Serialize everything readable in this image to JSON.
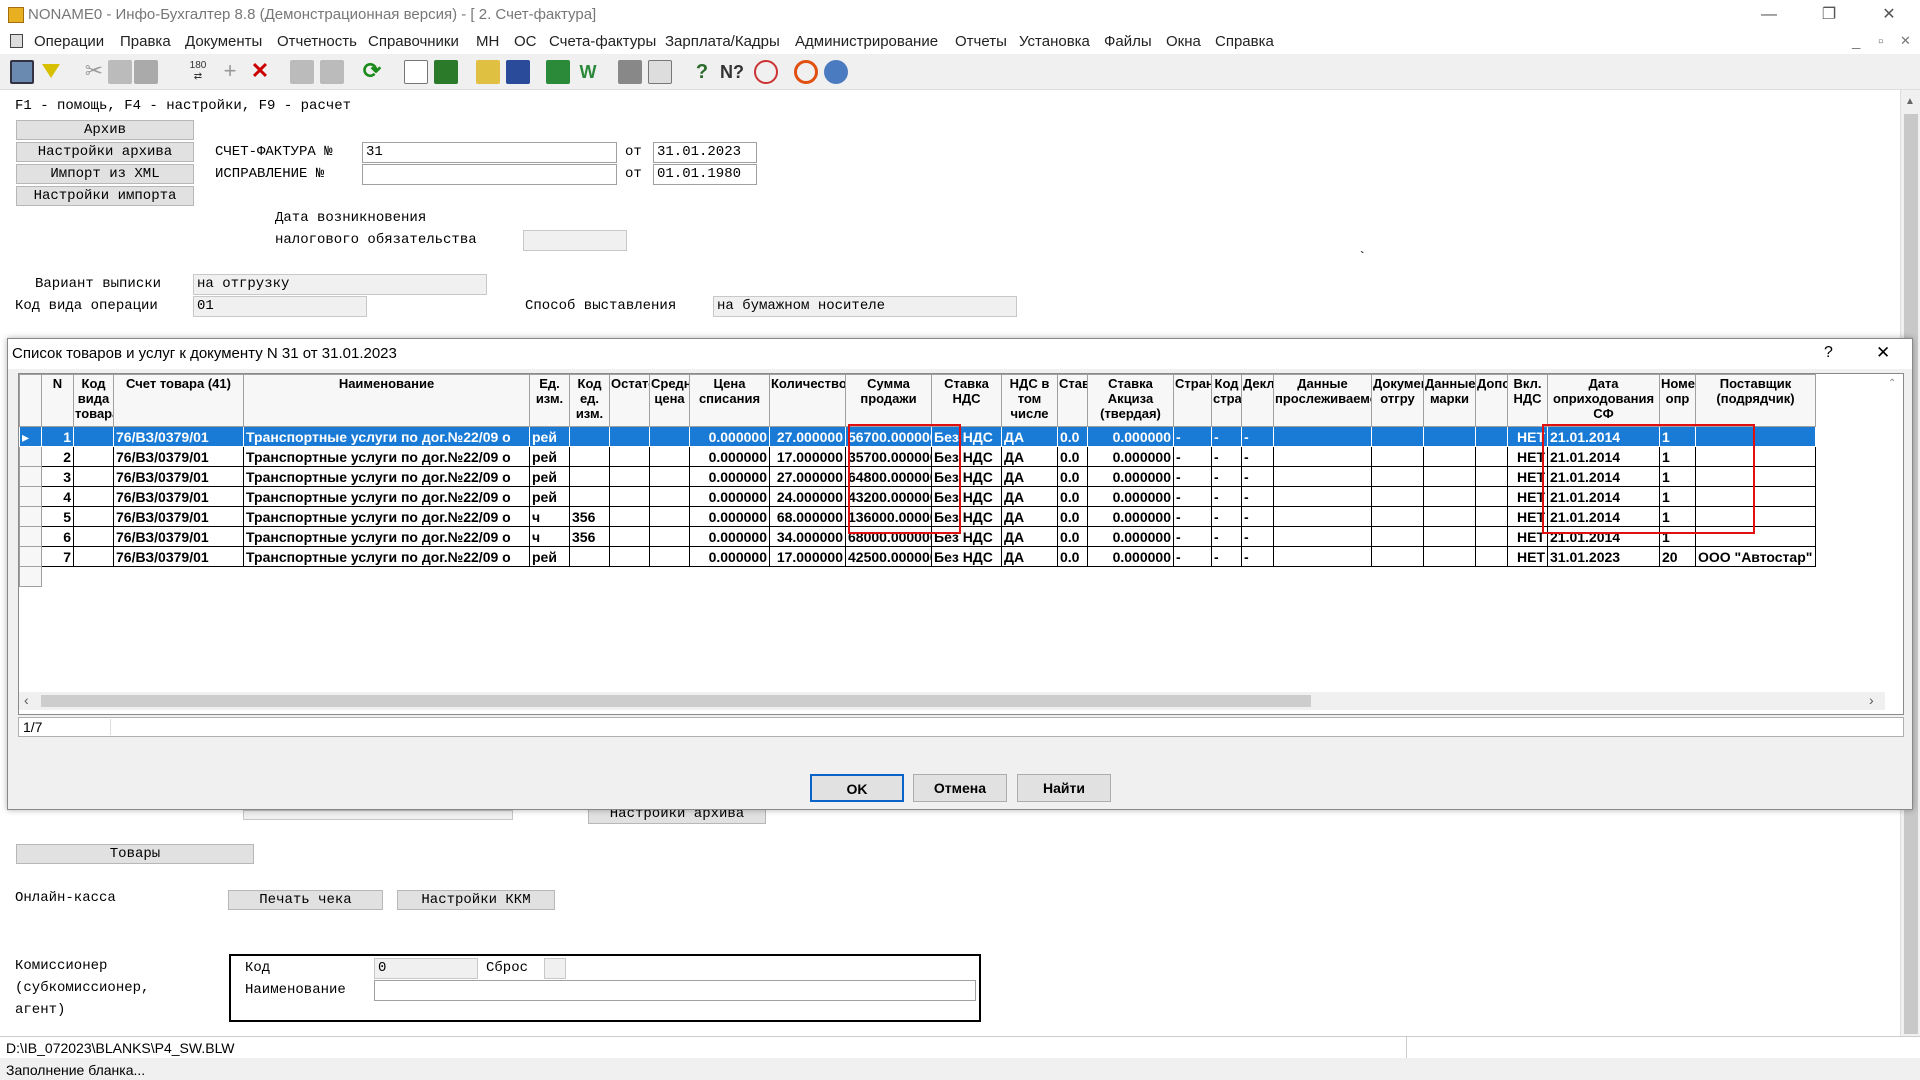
{
  "window": {
    "title": "NONAME0 - Инфо-Бухгалтер 8.8 (Демонстрационная версия) - [  2. Счет-фактура]",
    "minimize": "—",
    "maximize": "❐",
    "close": "✕"
  },
  "menu": [
    "Операции",
    "Правка",
    "Документы",
    "Отчетность",
    "Справочники",
    "МН",
    "ОС",
    "Счета-фактуры",
    "Зарплата/Кадры",
    "Администрирование",
    "Отчеты",
    "Установка",
    "Файлы",
    "Окна",
    "Справка"
  ],
  "mdi_controls": [
    "_",
    "▫",
    "✕"
  ],
  "form": {
    "hint": "F1 - помощь, F4 - настройки, F9 - расчет",
    "btn_archive": "Архив",
    "btn_archive_settings": "Настройки архива",
    "btn_import_xml": "Импорт из XML",
    "btn_import_settings": "Настройки импорта",
    "invoice_label": "СЧЕТ-ФАКТУРА №",
    "invoice_no": "31",
    "from1": "от",
    "invoice_date": "31.01.2023",
    "correction_label": "ИСПРАВЛЕНИЕ  №",
    "correction_no": "",
    "from2": "от",
    "correction_date": "01.01.1980",
    "tax_date_label1": "Дата возникновения",
    "tax_date_label2": "налогового обязательства",
    "tax_date": "",
    "variant_label": "Вариант выписки",
    "variant_value": "на отгрузку",
    "opcode_label": "Код вида операции",
    "opcode_value": "01",
    "method_label": "Способ выставления",
    "method_value": "на бумажном носителе",
    "backtick": "`",
    "btn_archive_settings2": "Настройки архива",
    "btn_goods": "Товары",
    "online_kassa": "Онлайн-касса",
    "btn_print_check": "Печать чека",
    "btn_kkm_settings": "Настройки ККМ",
    "commissioner1": "Комиссионер",
    "commissioner2": "(субкомиссионер,",
    "commissioner3": "агент)",
    "code_label": "Код",
    "code_value": "0",
    "reset_label": "Сброс",
    "name_label": "Наименование",
    "name_value": ""
  },
  "dialog": {
    "title": "Список товаров и услуг к документу N 31 от 31.01.2023",
    "help": "?",
    "close": "✕",
    "columns": [
      "N",
      "Код вида товара",
      "Счет товара (41)",
      "Наименование",
      "Ед. изм.",
      "Код ед. изм.",
      "Остаток",
      "Средняя цена",
      "Цена списания",
      "Количество",
      "Сумма продажи",
      "Ставка НДС",
      "НДС в том числе",
      "Ставка",
      "Ставка Акциза (твердая)",
      "Страна",
      "Код страны",
      "Декларации",
      "Данные прослеживаемости",
      "Документы отгру",
      "Данные марки",
      "Дополнит",
      "Вкл. НДС",
      "Дата оприходования СФ",
      "Номер опр",
      "Поставщик (подрядчик)"
    ],
    "rows": [
      [
        "1",
        "",
        "76/ВЗ/0379/01",
        "Транспортные услуги по дог.№22/09 о",
        "рей",
        "",
        "",
        "",
        "0.000000",
        "27.000000",
        "56700.000000",
        "Без НДС",
        "ДА",
        "0.0",
        "0.000000",
        "-",
        "-",
        "-",
        "",
        "",
        "",
        "",
        "НЕТ",
        "21.01.2014",
        "1",
        ""
      ],
      [
        "2",
        "",
        "76/ВЗ/0379/01",
        "Транспортные услуги по дог.№22/09 о",
        "рей",
        "",
        "",
        "",
        "0.000000",
        "17.000000",
        "35700.000000",
        "Без НДС",
        "ДА",
        "0.0",
        "0.000000",
        "-",
        "-",
        "-",
        "",
        "",
        "",
        "",
        "НЕТ",
        "21.01.2014",
        "1",
        ""
      ],
      [
        "3",
        "",
        "76/ВЗ/0379/01",
        "Транспортные услуги по дог.№22/09 о",
        "рей",
        "",
        "",
        "",
        "0.000000",
        "27.000000",
        "64800.000000",
        "Без НДС",
        "ДА",
        "0.0",
        "0.000000",
        "-",
        "-",
        "-",
        "",
        "",
        "",
        "",
        "НЕТ",
        "21.01.2014",
        "1",
        ""
      ],
      [
        "4",
        "",
        "76/ВЗ/0379/01",
        "Транспортные услуги по дог.№22/09 о",
        "рей",
        "",
        "",
        "",
        "0.000000",
        "24.000000",
        "43200.000000",
        "Без НДС",
        "ДА",
        "0.0",
        "0.000000",
        "-",
        "-",
        "-",
        "",
        "",
        "",
        "",
        "НЕТ",
        "21.01.2014",
        "1",
        ""
      ],
      [
        "5",
        "",
        "76/ВЗ/0379/01",
        "Транспортные услуги по дог.№22/09 о",
        "ч",
        "356",
        "",
        "",
        "0.000000",
        "68.000000",
        "136000.000000",
        "Без НДС",
        "ДА",
        "0.0",
        "0.000000",
        "-",
        "-",
        "-",
        "",
        "",
        "",
        "",
        "НЕТ",
        "21.01.2014",
        "1",
        ""
      ],
      [
        "6",
        "",
        "76/ВЗ/0379/01",
        "Транспортные услуги по дог.№22/09 о",
        "ч",
        "356",
        "",
        "",
        "0.000000",
        "34.000000",
        "68000.000000",
        "Без НДС",
        "ДА",
        "0.0",
        "0.000000",
        "-",
        "-",
        "-",
        "",
        "",
        "",
        "",
        "НЕТ",
        "21.01.2014",
        "1",
        ""
      ],
      [
        "7",
        "",
        "76/ВЗ/0379/01",
        "Транспортные услуги по дог.№22/09 о",
        "рей",
        "",
        "",
        "",
        "0.000000",
        "17.000000",
        "42500.000000",
        "Без НДС",
        "ДА",
        "0.0",
        "0.000000",
        "-",
        "-",
        "-",
        "",
        "",
        "",
        "",
        "НЕТ",
        "31.01.2023",
        "20",
        "ООО \"Автостар\""
      ]
    ],
    "position": "1/7",
    "ok": "OK",
    "cancel": "Отмена",
    "find": "Найти"
  },
  "status": {
    "path": "D:\\IB_072023\\BLANKS\\P4_SW.BLW",
    "message": "Заполнение бланка..."
  }
}
